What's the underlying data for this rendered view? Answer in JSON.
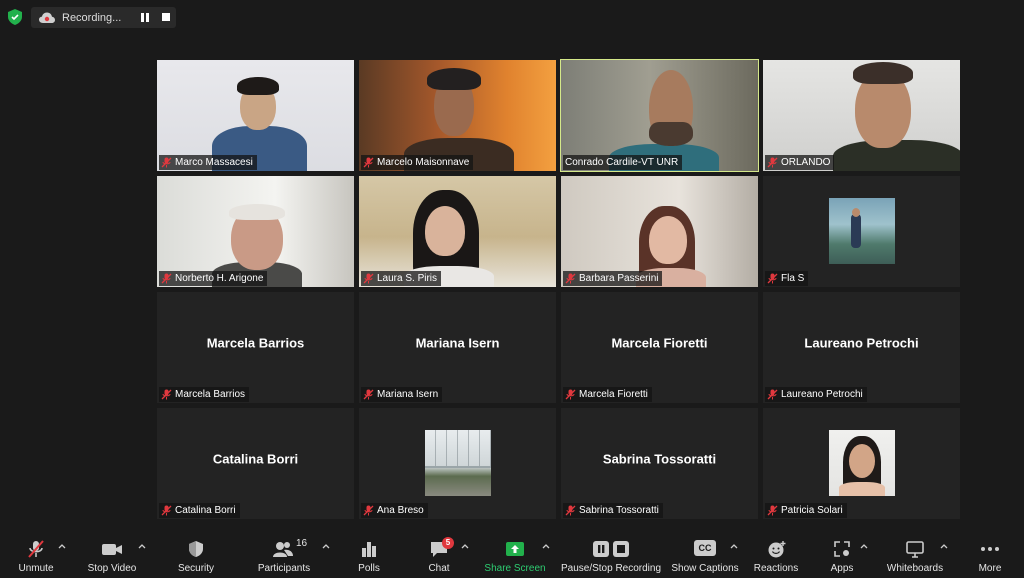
{
  "top": {
    "recording_label": "Recording..."
  },
  "tiles": [
    {
      "name": "Marco Massacesi",
      "type": "video",
      "scene": "marco"
    },
    {
      "name": "Marcelo Maisonnave",
      "type": "video",
      "scene": "maison"
    },
    {
      "name": "Conrado Cardile-VT UNR",
      "type": "video",
      "scene": "conrado",
      "active": true
    },
    {
      "name": "ORLANDO",
      "type": "video",
      "scene": "orlando"
    },
    {
      "name": "Norberto H. Arigone",
      "type": "video",
      "scene": "norberto"
    },
    {
      "name": "Laura S. Piris",
      "type": "video",
      "scene": "laura"
    },
    {
      "name": "Barbara Passerini",
      "type": "video",
      "scene": "barbara"
    },
    {
      "name": "Fla S",
      "type": "photo",
      "thumb": "flas"
    },
    {
      "name": "Marcela Barrios",
      "type": "text",
      "display": "Marcela Barrios"
    },
    {
      "name": "Mariana Isern",
      "type": "text",
      "display": "Mariana Isern"
    },
    {
      "name": "Marcela Fioretti",
      "type": "text",
      "display": "Marcela Fioretti"
    },
    {
      "name": "Laureano Petrochi",
      "type": "text",
      "display": "Laureano Petrochi"
    },
    {
      "name": "Catalina Borri",
      "type": "text",
      "display": "Catalina Borri"
    },
    {
      "name": "Ana Breso",
      "type": "photo",
      "thumb": "ana"
    },
    {
      "name": "Sabrina Tossoratti",
      "type": "text",
      "display": "Sabrina Tossoratti"
    },
    {
      "name": "Patricia Solari",
      "type": "photo",
      "thumb": "patricia"
    }
  ],
  "toolbar": {
    "unmute": "Unmute",
    "stop_video": "Stop Video",
    "security": "Security",
    "participants": "Participants",
    "participants_count": "16",
    "polls": "Polls",
    "chat": "Chat",
    "chat_badge": "5",
    "share_screen": "Share Screen",
    "pause_stop_recording": "Pause/Stop Recording",
    "show_captions": "Show Captions",
    "captions_icon_text": "CC",
    "reactions": "Reactions",
    "apps": "Apps",
    "whiteboards": "Whiteboards",
    "more": "More"
  },
  "colors": {
    "active_speaker": "#d5e98a",
    "share_green": "#2ecc71",
    "badge_red": "#e0383e",
    "mic_off_red": "#e0383e"
  }
}
